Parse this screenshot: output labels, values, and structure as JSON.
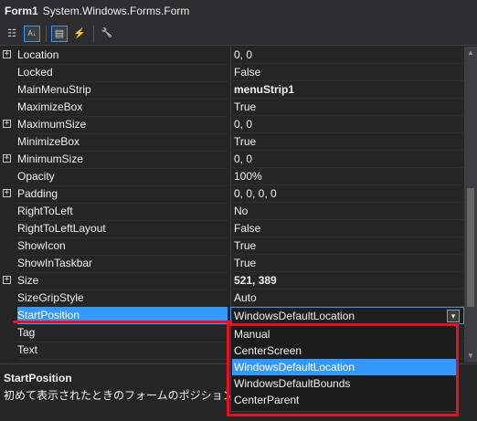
{
  "header": {
    "object_name": "Form1",
    "object_type": "System.Windows.Forms.Form"
  },
  "toolbar": {
    "buttons": [
      {
        "name": "categorized-icon",
        "glyph": "☷"
      },
      {
        "name": "alphabetical-icon",
        "glyph": "A↓"
      },
      {
        "name": "properties-icon",
        "glyph": "▤"
      },
      {
        "name": "events-icon",
        "glyph": "⚡"
      },
      {
        "name": "property-pages-icon",
        "glyph": "🔧"
      }
    ]
  },
  "properties": [
    {
      "name": "Location",
      "value": "0, 0",
      "expandable": true,
      "bold": false
    },
    {
      "name": "Locked",
      "value": "False",
      "expandable": false,
      "bold": false
    },
    {
      "name": "MainMenuStrip",
      "value": "menuStrip1",
      "expandable": false,
      "bold": true
    },
    {
      "name": "MaximizeBox",
      "value": "True",
      "expandable": false,
      "bold": false
    },
    {
      "name": "MaximumSize",
      "value": "0, 0",
      "expandable": true,
      "bold": false
    },
    {
      "name": "MinimizeBox",
      "value": "True",
      "expandable": false,
      "bold": false
    },
    {
      "name": "MinimumSize",
      "value": "0, 0",
      "expandable": true,
      "bold": false
    },
    {
      "name": "Opacity",
      "value": "100%",
      "expandable": false,
      "bold": false
    },
    {
      "name": "Padding",
      "value": "0, 0, 0, 0",
      "expandable": true,
      "bold": false
    },
    {
      "name": "RightToLeft",
      "value": "No",
      "expandable": false,
      "bold": false
    },
    {
      "name": "RightToLeftLayout",
      "value": "False",
      "expandable": false,
      "bold": false
    },
    {
      "name": "ShowIcon",
      "value": "True",
      "expandable": false,
      "bold": false
    },
    {
      "name": "ShowInTaskbar",
      "value": "True",
      "expandable": false,
      "bold": false
    },
    {
      "name": "Size",
      "value": "521, 389",
      "expandable": true,
      "bold": true
    },
    {
      "name": "SizeGripStyle",
      "value": "Auto",
      "expandable": false,
      "bold": false
    },
    {
      "name": "StartPosition",
      "value": "WindowsDefaultLocation",
      "expandable": false,
      "bold": false,
      "selected": true
    },
    {
      "name": "Tag",
      "value": "",
      "expandable": false,
      "bold": false
    },
    {
      "name": "Text",
      "value": "",
      "expandable": false,
      "bold": false
    }
  ],
  "dropdown": {
    "options": [
      "Manual",
      "CenterScreen",
      "WindowsDefaultLocation",
      "WindowsDefaultBounds",
      "CenterParent"
    ],
    "selected": "WindowsDefaultLocation"
  },
  "description": {
    "title": "StartPosition",
    "text": "初めて表示されたときのフォームのポジションを決定し"
  },
  "colors": {
    "background": "#252526",
    "selection": "#3399ff",
    "annotation_highlight": "#e81123"
  }
}
